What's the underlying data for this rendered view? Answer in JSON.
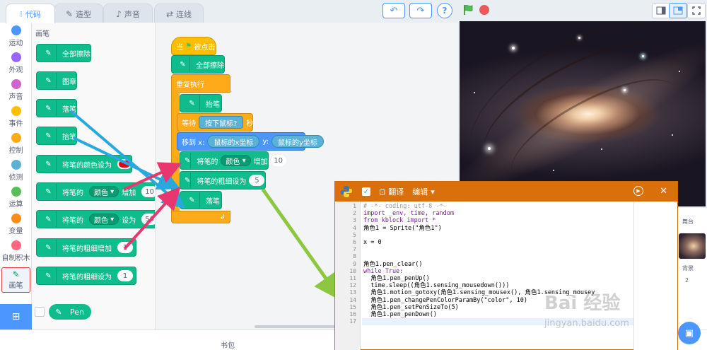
{
  "tabs": [
    {
      "label": "代码",
      "icon": "code-icon"
    },
    {
      "label": "造型",
      "icon": "brush-icon"
    },
    {
      "label": "声音",
      "icon": "speaker-icon"
    },
    {
      "label": "连线",
      "icon": "connect-icon"
    }
  ],
  "toolbar": {
    "undo": "↶",
    "redo": "↷",
    "help": "?"
  },
  "categories": [
    "运动",
    "外观",
    "声音",
    "事件",
    "控制",
    "侦测",
    "运算",
    "变量",
    "自制积木",
    "画笔"
  ],
  "category_colors": [
    "#4c97ff",
    "#9966ff",
    "#cf63cf",
    "#ffbf00",
    "#ffab19",
    "#5cb1d6",
    "#59c059",
    "#ff8c1a",
    "#ff6680"
  ],
  "palette": {
    "title": "画笔",
    "blocks": {
      "clear": "全部擦除",
      "stamp": "图章",
      "pen_down": "落笔",
      "pen_up": "抬笔",
      "set_color_to": "将笔的颜色设为",
      "change_param_prefix": "将笔的",
      "change_param_dropdown": "颜色",
      "change_param_by": "增加",
      "change_param_value": "10",
      "set_param_prefix": "将笔的",
      "set_param_dropdown": "颜色",
      "set_param_to": "设为",
      "set_param_value": "50",
      "change_size_by": "将笔的粗细增加",
      "change_size_value": "1",
      "set_size_to": "将笔的粗细设为",
      "set_size_value": "1",
      "extension_label": "Pen"
    }
  },
  "script": {
    "hat": "当",
    "hat_tail": "被点击",
    "clear": "全部擦除",
    "forever": "重复执行",
    "pen_up": "抬笔",
    "wait": "等待",
    "wait_condition": "按下鼠标?",
    "wait_unit": "秒",
    "goto": "移到 x:",
    "mouse_x": "鼠标的x坐标",
    "goto_y": "y:",
    "mouse_y": "鼠标的y坐标",
    "change_color_prefix": "将笔的",
    "change_color_dropdown": "颜色",
    "change_color_by": "增加",
    "change_color_value": "10",
    "set_size": "将笔的粗细设为",
    "set_size_value": "5",
    "pen_down": "落笔"
  },
  "bottom": {
    "bookbag": "书包"
  },
  "sprite_panel": {
    "stage_label": "舞台",
    "backdrop_label": "背景",
    "backdrop_count": "2"
  },
  "python_window": {
    "translate": "翻译",
    "edit": "编辑",
    "line_numbers": [
      "1",
      "2",
      "3",
      "4",
      "5",
      "6",
      "7",
      "8",
      "9",
      "10",
      "11",
      "12",
      "13",
      "14",
      "15",
      "16",
      "17"
    ],
    "lines": [
      "# -*- coding: utf-8 -*-",
      "import _env, time, random",
      "from kblock import *",
      "角色1 = Sprite(\"角色1\")",
      "",
      "x = 0",
      "",
      "",
      "角色1.pen_clear()",
      "while True:",
      "  角色1.pen_penUp()",
      "  time.sleep((角色1.sensing_mousedown()))",
      "  角色1.motion_gotoxy(角色1.sensing_mousex(), 角色1.sensing_mousey",
      "  角色1.pen_changePenColorParamBy(\"color\", 10)",
      "  角色1.pen_setPenSizeTo(5)",
      "  角色1.pen_penDown()",
      ""
    ]
  },
  "watermark": {
    "text": "Bai 经验",
    "url": "jingyan.baidu.com"
  },
  "colors": {
    "pen": "#0fbd8c",
    "motion": "#4c97ff",
    "control": "#ffab19",
    "events": "#ffbf00",
    "sensing": "#5cb1d6",
    "python_header": "#d9700b",
    "swatch": "#e60012"
  }
}
